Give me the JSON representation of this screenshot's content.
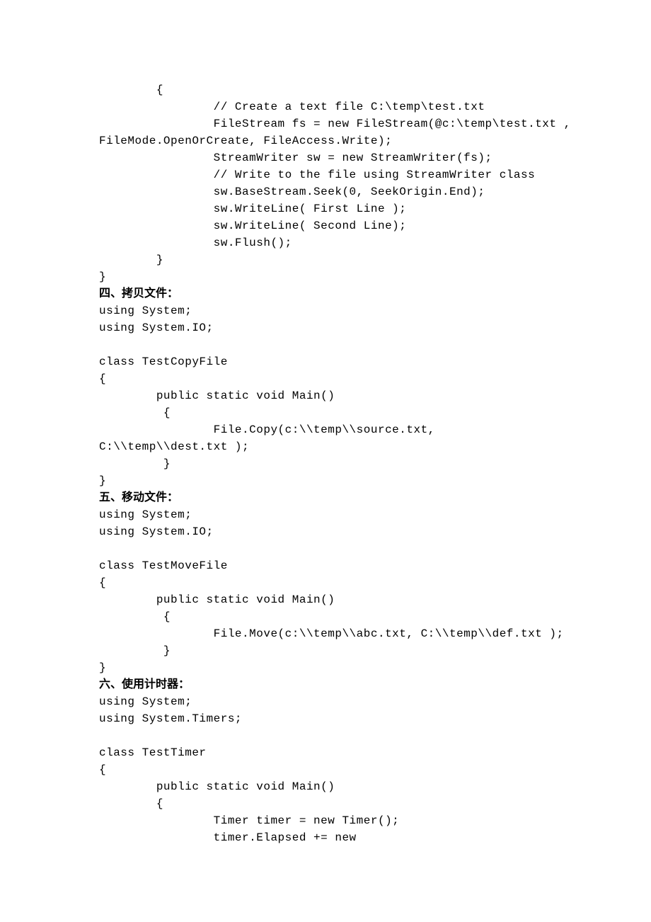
{
  "lines": [
    {
      "type": "code",
      "text": "        {"
    },
    {
      "type": "code",
      "text": "                // Create a text file C:\\temp\\test.txt"
    },
    {
      "type": "code",
      "text": "                FileStream fs = new FileStream(@c:\\temp\\test.txt , "
    },
    {
      "type": "code",
      "text": "FileMode.OpenOrCreate, FileAccess.Write);"
    },
    {
      "type": "code",
      "text": "                StreamWriter sw = new StreamWriter(fs);"
    },
    {
      "type": "code",
      "text": "                // Write to the file using StreamWriter class"
    },
    {
      "type": "code",
      "text": "                sw.BaseStream.Seek(0, SeekOrigin.End);"
    },
    {
      "type": "code",
      "text": "                sw.WriteLine( First Line );"
    },
    {
      "type": "code",
      "text": "                sw.WriteLine( Second Line);"
    },
    {
      "type": "code",
      "text": "                sw.Flush();"
    },
    {
      "type": "code",
      "text": "        }"
    },
    {
      "type": "code",
      "text": "}"
    },
    {
      "type": "heading",
      "text": "四、拷贝文件："
    },
    {
      "type": "code",
      "text": "using System;"
    },
    {
      "type": "code",
      "text": "using System.IO;"
    },
    {
      "type": "blank",
      "text": ""
    },
    {
      "type": "code",
      "text": "class TestCopyFile"
    },
    {
      "type": "code",
      "text": "{"
    },
    {
      "type": "code",
      "text": "        public static void Main()"
    },
    {
      "type": "code",
      "text": "         {"
    },
    {
      "type": "code",
      "text": "                File.Copy(c:\\\\temp\\\\source.txt, "
    },
    {
      "type": "code",
      "text": "C:\\\\temp\\\\dest.txt );"
    },
    {
      "type": "code",
      "text": "         }"
    },
    {
      "type": "code",
      "text": "}"
    },
    {
      "type": "heading",
      "text": "五、移动文件："
    },
    {
      "type": "code",
      "text": "using System;"
    },
    {
      "type": "code",
      "text": "using System.IO;"
    },
    {
      "type": "blank",
      "text": ""
    },
    {
      "type": "code",
      "text": "class TestMoveFile"
    },
    {
      "type": "code",
      "text": "{"
    },
    {
      "type": "code",
      "text": "        public static void Main()"
    },
    {
      "type": "code",
      "text": "         {"
    },
    {
      "type": "code",
      "text": "                File.Move(c:\\\\temp\\\\abc.txt, C:\\\\temp\\\\def.txt );"
    },
    {
      "type": "code",
      "text": "         }"
    },
    {
      "type": "code",
      "text": "}"
    },
    {
      "type": "heading",
      "text": "六、使用计时器："
    },
    {
      "type": "code",
      "text": "using System;"
    },
    {
      "type": "code",
      "text": "using System.Timers;"
    },
    {
      "type": "blank",
      "text": ""
    },
    {
      "type": "code",
      "text": "class TestTimer"
    },
    {
      "type": "code",
      "text": "{"
    },
    {
      "type": "code",
      "text": "        public static void Main()"
    },
    {
      "type": "code",
      "text": "        {"
    },
    {
      "type": "code",
      "text": "                Timer timer = new Timer();"
    },
    {
      "type": "code",
      "text": "                timer.Elapsed += new "
    }
  ]
}
